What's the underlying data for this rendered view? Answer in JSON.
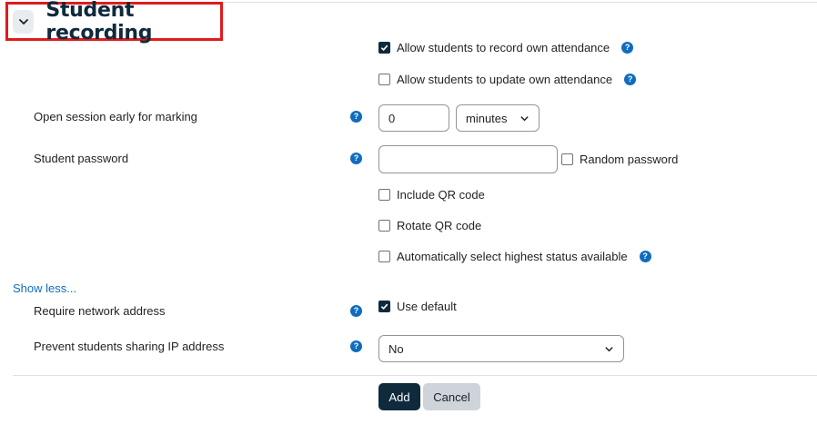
{
  "section": {
    "title": "Student recording"
  },
  "options": {
    "allow_record": {
      "label": "Allow students to record own attendance",
      "checked": true
    },
    "allow_update": {
      "label": "Allow students to update own attendance",
      "checked": false
    },
    "include_qr": {
      "label": "Include QR code",
      "checked": false
    },
    "rotate_qr": {
      "label": "Rotate QR code",
      "checked": false
    },
    "auto_highest": {
      "label": "Automatically select highest status available",
      "checked": false
    }
  },
  "open_early": {
    "label": "Open session early for marking",
    "value": "0",
    "unit": "minutes"
  },
  "password": {
    "label": "Student password",
    "value": "",
    "random_label": "Random password",
    "random_checked": false
  },
  "show_less": "Show less...",
  "network": {
    "label": "Require network address",
    "use_default_label": "Use default",
    "use_default_checked": true
  },
  "prevent_ip": {
    "label": "Prevent students sharing IP address",
    "value": "No"
  },
  "help_glyph": "?",
  "actions": {
    "add": "Add",
    "cancel": "Cancel"
  },
  "colors": {
    "primary": "#0f2a3d",
    "link": "#0f6cbf",
    "highlight_border": "#e01b1b"
  }
}
